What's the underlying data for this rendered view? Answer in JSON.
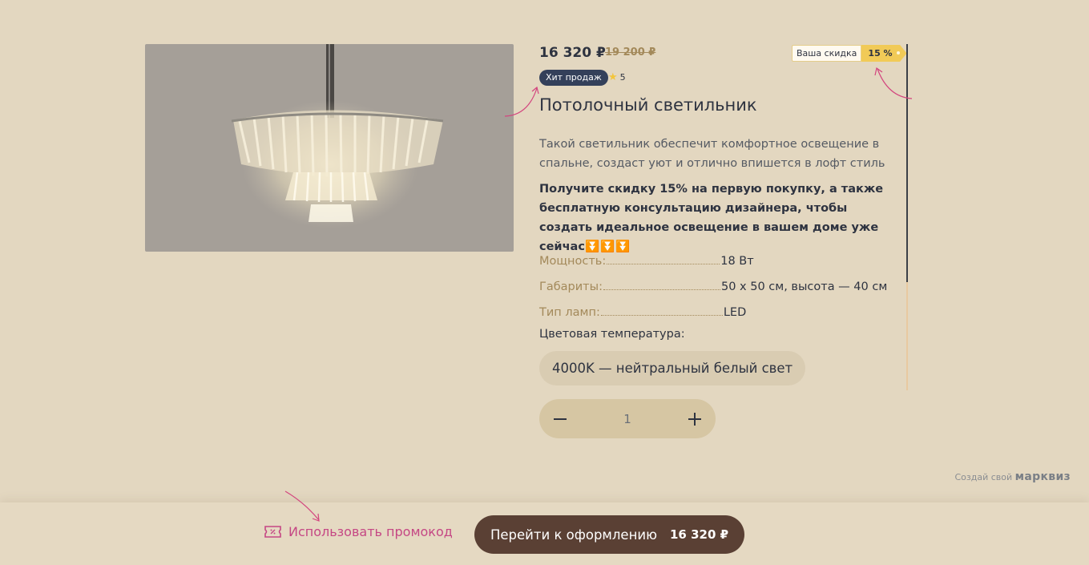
{
  "product": {
    "price": "16 320 ₽",
    "old_price": "19 200 ₽",
    "discount_label": "Ваша скидка",
    "discount_value": "15 %",
    "badge": "Хит продаж",
    "rating": "5",
    "title": "Потолочный светильник",
    "description": "Такой светильник обеспечит комфортное освещение в спальне, создаст уют и отлично впишется в лофт стиль",
    "promo_text": "Получите скидку 15% на первую покупку, а также бесплатную консультацию дизайнера, чтобы создать идеальное освещение в вашем доме уже сейчас",
    "promo_arrows": "⏬⏬⏬",
    "specs": [
      {
        "key": "Мощность:",
        "value": "18 Вт"
      },
      {
        "key": "Габариты:",
        "value": "50 х 50 см, высота — 40 см"
      },
      {
        "key": "Тип ламп:",
        "value": "LED"
      }
    ],
    "color_temp_label": "Цветовая температура:",
    "color_temp_value": "4000K — нейтральный белый свет",
    "quantity": "1"
  },
  "footer": {
    "credit_prefix": "Создай свой",
    "credit_brand": "марквиз",
    "promo_button": "Использовать промокод",
    "checkout_label": "Перейти к оформлению",
    "checkout_sum": "16 320 ₽"
  },
  "icons": {
    "star": "star-icon",
    "minus": "minus-icon",
    "plus": "plus-icon",
    "coupon": "coupon-icon"
  },
  "colors": {
    "background": "#e3d7c0",
    "accent_gold": "#a3895a",
    "checkout_button": "#5a4034",
    "promo_pink": "#c54784",
    "discount_yellow": "#f1ca57",
    "badge_navy": "#34405a"
  }
}
